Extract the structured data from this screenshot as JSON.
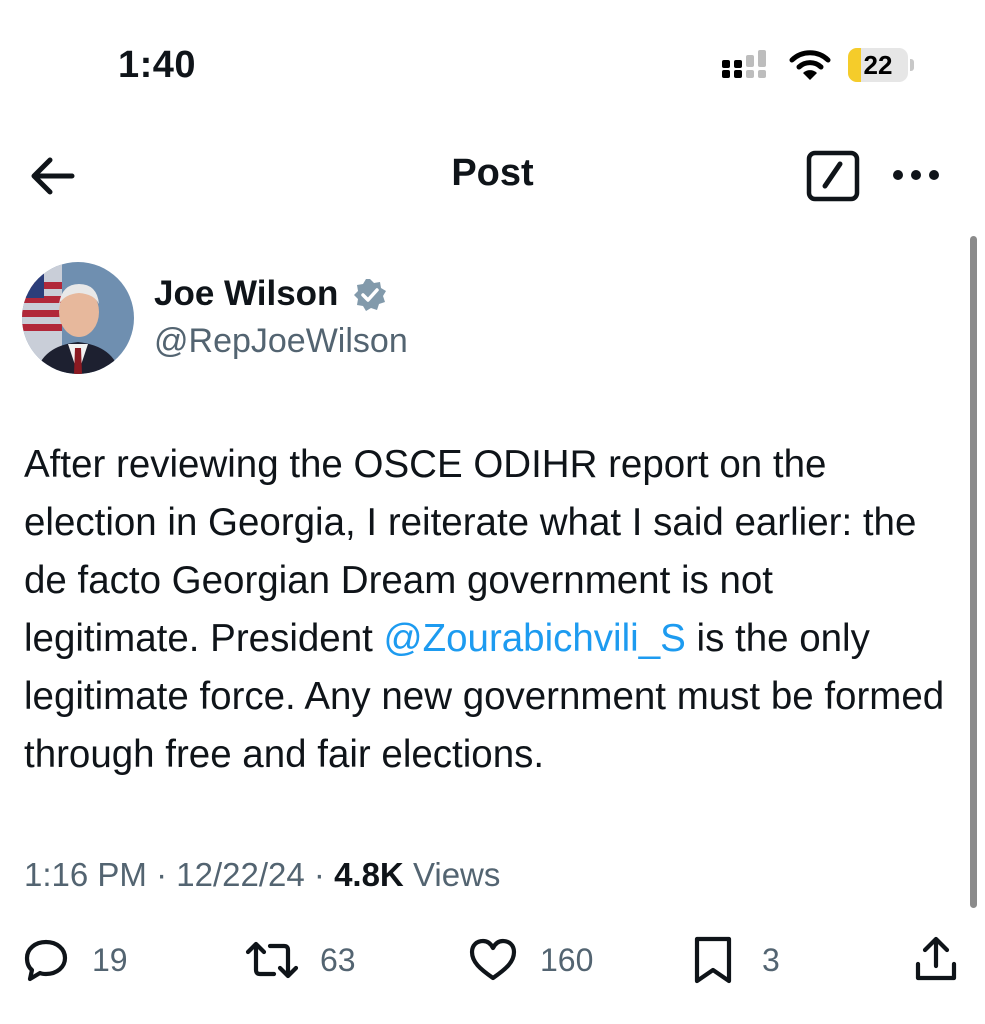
{
  "status_bar": {
    "time": "1:40",
    "battery_level": "22",
    "battery_fill_fraction": 0.22
  },
  "header": {
    "title": "Post"
  },
  "post": {
    "author": {
      "name": "Joe Wilson",
      "handle": "@RepJoeWilson"
    },
    "text": {
      "part1": "After reviewing the OSCE ODIHR report on the election in Georgia, I reiterate what I said earlier: the de facto Georgian Dream government is not legitimate. President ",
      "mention": "@Zourabichvili_S",
      "part2": " is the only legitimate force. Any new government must be formed through free and fair elections."
    },
    "meta": {
      "time": "1:16 PM",
      "separator": "·",
      "date": "12/22/24",
      "views_count": "4.8K",
      "views_label": "Views"
    },
    "actions": {
      "replies": "19",
      "reposts": "63",
      "likes": "160",
      "bookmarks": "3"
    }
  },
  "icons": {
    "back": "arrow-left-icon",
    "compose": "compose-icon",
    "more": "more-icon",
    "verified": "verified-badge-icon",
    "reply": "reply-icon",
    "repost": "repost-icon",
    "like": "heart-icon",
    "bookmark": "bookmark-icon",
    "share": "share-icon"
  },
  "colors": {
    "mention": "#1d9bf0",
    "secondary_text": "#536471",
    "primary_text": "#0f1419",
    "battery": "#f5cc2a"
  }
}
